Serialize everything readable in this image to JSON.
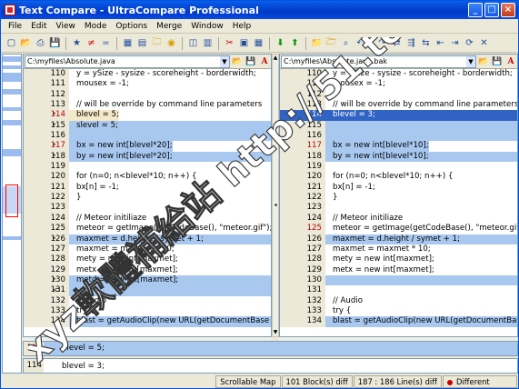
{
  "window": {
    "title": "Text Compare - UltraCompare Professional"
  },
  "menu": [
    "File",
    "Edit",
    "View",
    "Mode",
    "Options",
    "Merge",
    "Window",
    "Help"
  ],
  "toolbar_icons": [
    "new-icon",
    "open-icon",
    "print-icon",
    "save-icon",
    "star-icon",
    "not-equal-icon",
    "equal-icon",
    "grid-icon",
    "grid2-icon",
    "folder-icon",
    "disk-icon",
    "split-horizontal-icon",
    "split-vertical-icon",
    "cut-icon",
    "table-icon",
    "table2-icon",
    "arrow-down-icon",
    "arrow-up-icon",
    "folder-open-icon",
    "folder-merge-icon",
    "binoculars-icon",
    "undo-icon",
    "redo-icon",
    "merge-icon",
    "merge-all-icon",
    "compare-icon",
    "merge-left-icon",
    "merge-right-icon",
    "sync-icon",
    "close-icon"
  ],
  "left": {
    "path": "C:\\myfiles\\Absolute.java",
    "lines": [
      {
        "n": "110",
        "code": "y = ySize - sysize - scoreheight - borderwidth;",
        "t": ""
      },
      {
        "n": "111",
        "code": "mousex = -1;",
        "t": ""
      },
      {
        "n": "112",
        "code": "",
        "t": ""
      },
      {
        "n": "113",
        "code": "// will be override by command line parameters",
        "t": ""
      },
      {
        "n": "114",
        "code": "blevel = 5;",
        "t": "chgdiff",
        "mk": "*"
      },
      {
        "n": "115",
        "code": "slevel = 5;",
        "t": "diff",
        "mk": "*"
      },
      {
        "n": "116",
        "code": "",
        "t": "diff"
      },
      {
        "n": "117",
        "code": "bx = new int[blevel*20];",
        "t": "chgdiff",
        "mk": "*"
      },
      {
        "n": "118",
        "code": "by = new int[blevel*20];",
        "t": "diff",
        "mk": "*"
      },
      {
        "n": "119",
        "code": "",
        "t": ""
      },
      {
        "n": "120",
        "code": "for (n=0; n<blevel*10; n++) {",
        "t": ""
      },
      {
        "n": "121",
        "code": "bx[n] = -1;",
        "t": ""
      },
      {
        "n": "122",
        "code": "}",
        "t": ""
      },
      {
        "n": "123",
        "code": "",
        "t": ""
      },
      {
        "n": "124",
        "code": "// Meteor initiliaze",
        "t": ""
      },
      {
        "n": "125",
        "code": "meteor = getImage(getCodeBase(), \"meteor.gif\");",
        "t": ""
      },
      {
        "n": "126",
        "code": "maxmet = d.height / symet + 1;",
        "t": "diff",
        "mk": "*"
      },
      {
        "n": "127",
        "code": "maxmet = maxmet * 10;",
        "t": ""
      },
      {
        "n": "128",
        "code": "mety = new int[maxmet];",
        "t": ""
      },
      {
        "n": "129",
        "code": "metx = new int[maxmet];",
        "t": ""
      },
      {
        "n": "130",
        "code": "metd = new int[maxmet];",
        "t": "diff",
        "mk": "*"
      },
      {
        "n": "131",
        "code": "",
        "t": "diff",
        "mk": "<!"
      },
      {
        "n": "132",
        "code": "// Audio",
        "t": ""
      },
      {
        "n": "133",
        "code": "try {",
        "t": ""
      },
      {
        "n": "134",
        "code": "blast = getAudioClip(new URL(getDocumentBase",
        "t": "diff"
      }
    ]
  },
  "right": {
    "path": "C:\\myfiles\\Absolute.java.bak",
    "lines": [
      {
        "n": "110",
        "code": "y = ySize - sysize - scoreheight - borderwidth;",
        "t": ""
      },
      {
        "n": "111",
        "code": "mousex = -1;",
        "t": ""
      },
      {
        "n": "112",
        "code": "",
        "t": ""
      },
      {
        "n": "113",
        "code": "// will be override by command line parameters",
        "t": ""
      },
      {
        "n": "114",
        "code": "blevel = 3;",
        "t": "sel"
      },
      {
        "n": "115",
        "code": "",
        "t": "diff"
      },
      {
        "n": "116",
        "code": "",
        "t": "diff"
      },
      {
        "n": "117",
        "code": "bx = new int[blevel*10];",
        "t": "chgdiff"
      },
      {
        "n": "118",
        "code": "by = new int[blevel*10];",
        "t": "diff"
      },
      {
        "n": "119",
        "code": "",
        "t": ""
      },
      {
        "n": "120",
        "code": "for (n=0; n<blevel*10; n++) {",
        "t": ""
      },
      {
        "n": "121",
        "code": "bx[n] = -1;",
        "t": ""
      },
      {
        "n": "122",
        "code": "}",
        "t": ""
      },
      {
        "n": "123",
        "code": "",
        "t": ""
      },
      {
        "n": "124",
        "code": "// Meteor initiliaze",
        "t": ""
      },
      {
        "n": "125",
        "code": "meteor = getImage(getCodeBase(), \"meteor.gif\");",
        "t": "chg"
      },
      {
        "n": "126",
        "code": "maxmet = d.height / symet + 1;",
        "t": "diff"
      },
      {
        "n": "127",
        "code": "maxmet = maxmet * 10;",
        "t": ""
      },
      {
        "n": "128",
        "code": "mety = new int[maxmet];",
        "t": ""
      },
      {
        "n": "129",
        "code": "metx = new int[maxmet];",
        "t": ""
      },
      {
        "n": "130",
        "code": "",
        "t": "diff"
      },
      {
        "n": "131",
        "code": "",
        "t": ""
      },
      {
        "n": "132",
        "code": "// Audio",
        "t": ""
      },
      {
        "n": "133",
        "code": "try {",
        "t": ""
      },
      {
        "n": "134",
        "code": "blast = getAudioClip(new URL(getDocumentBase",
        "t": "diff"
      }
    ]
  },
  "bottom": {
    "line1": {
      "n": "114",
      "text": "blevel = 5;"
    },
    "line2": {
      "n": "114",
      "text": "blevel = 3;"
    }
  },
  "status": {
    "map": "Scrollable Map",
    "blocks": "101 Block(s) diff",
    "lines": "187 : 186 Line(s) diff",
    "state": "Different"
  },
  "watermark": "xyz軟體補給站 http://51.to",
  "colors": {
    "diff": "#a8c8f0",
    "sel": "#3163c5",
    "changed_number": "#c00000",
    "title": "#0039c8"
  }
}
